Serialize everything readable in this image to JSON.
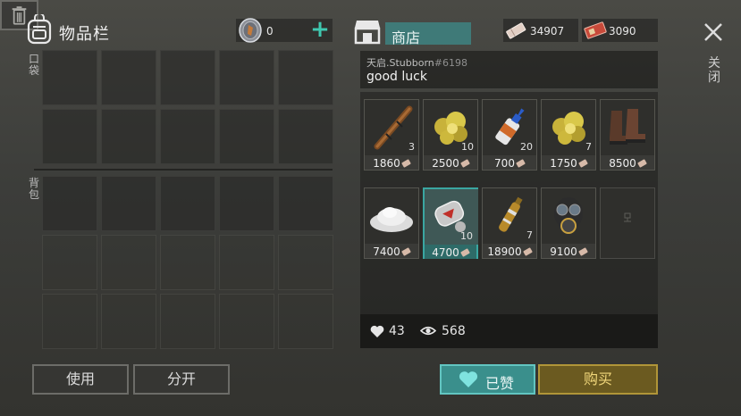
{
  "inventory": {
    "title": "物品栏",
    "coins": "0",
    "add_symbol": "+",
    "pocket_label": "口袋",
    "backpack_label": "背包"
  },
  "actions": {
    "use_label": "使用",
    "split_label": "分开"
  },
  "shop": {
    "title": "商店",
    "currency1": "34907",
    "currency2": "3090",
    "close_label": "关闭",
    "message": {
      "user": "天启.Stubborn",
      "id": "#6198",
      "text": "good luck"
    },
    "items": [
      {
        "icon": "wooden-stick-icon",
        "qty": "3",
        "price": "1860"
      },
      {
        "icon": "gold-ore-icon",
        "qty": "10",
        "price": "2500"
      },
      {
        "icon": "glue-tube-icon",
        "qty": "20",
        "price": "700"
      },
      {
        "icon": "gold-ore-icon",
        "qty": "7",
        "price": "1750"
      },
      {
        "icon": "boots-icon",
        "qty": "",
        "price": "8500"
      },
      {
        "icon": "salt-pile-icon",
        "qty": "",
        "price": "7400"
      },
      {
        "icon": "dog-tag-icon",
        "qty": "10",
        "price": "4700"
      },
      {
        "icon": "ampoule-icon",
        "qty": "7",
        "price": "18900"
      },
      {
        "icon": "gas-mask-icon",
        "qty": "",
        "price": "9100"
      },
      {
        "icon": "empty-slot-icon",
        "qty": "",
        "price": ""
      }
    ],
    "likes": "43",
    "views": "568"
  },
  "buttons": {
    "liked_label": "已赞",
    "buy_label": "购买"
  },
  "colors": {
    "accent_teal": "#3a8f8c",
    "buy_gold": "#b09538",
    "plus_green": "#3fc8b0"
  }
}
